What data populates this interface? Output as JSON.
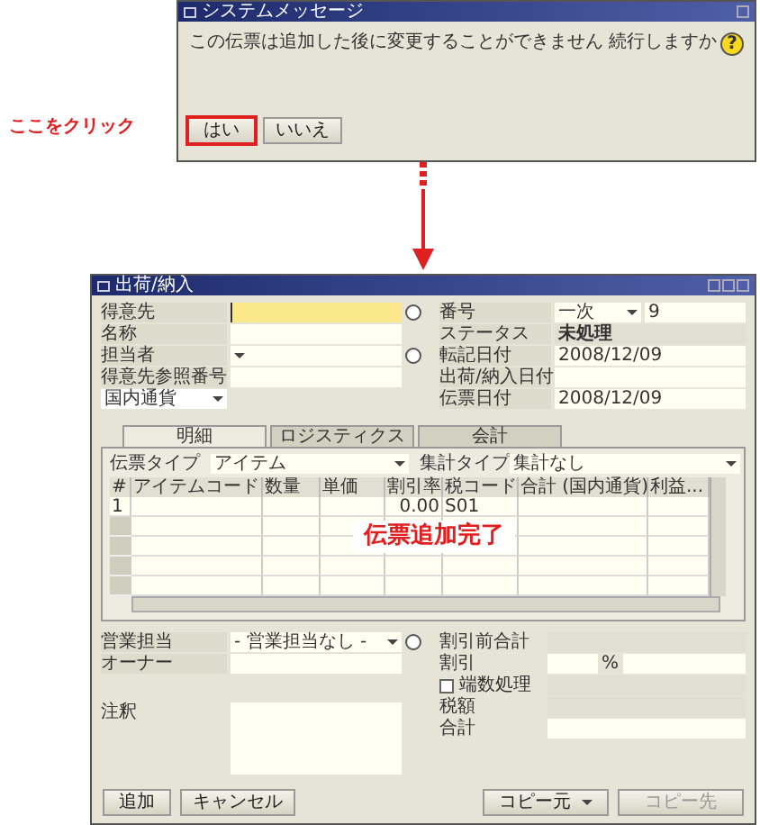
{
  "dialog": {
    "title": "システムメッセージ",
    "message": "この伝票は追加した後に変更することができません 続行しますか",
    "icon": "?",
    "buttons": [
      {
        "label": "はい",
        "highlighted": true
      },
      {
        "label": "いいえ",
        "highlighted": false
      }
    ]
  },
  "annotation": "ここをクリック",
  "window": {
    "title": "出荷/納入",
    "left_fields": [
      {
        "label": "得意先",
        "kind": "lookup",
        "focused": true
      },
      {
        "label": "名称",
        "kind": "text",
        "focused": false
      },
      {
        "label": "担当者",
        "kind": "dropdown",
        "focused": false
      },
      {
        "label": "得意先参照番号",
        "kind": "text",
        "focused": false
      }
    ],
    "currency": "国内通貨",
    "right_fields": [
      {
        "label": "番号",
        "kind": "series",
        "series": "一次",
        "value": "9"
      },
      {
        "label": "ステータス",
        "kind": "status",
        "value": "未処理"
      },
      {
        "label": "転記日付",
        "kind": "text",
        "value": "2008/12/09"
      },
      {
        "label": "出荷/納入日付",
        "kind": "text"
      },
      {
        "label": "伝票日付",
        "kind": "text",
        "value": "2008/12/09"
      }
    ],
    "tabs": [
      {
        "label": "明細",
        "selected": true
      },
      {
        "label": "ロジスティクス",
        "selected": false
      },
      {
        "label": "会計",
        "selected": false
      }
    ],
    "document_type": {
      "label": "伝票タイプ",
      "value": "アイテム"
    },
    "summary_type": {
      "label": "集計タイプ",
      "value": "集計なし"
    },
    "table": {
      "columns": [
        "#",
        "アイテムコード",
        "数量",
        "単価",
        "割引率",
        "税コード",
        "合計 (国内通貨)",
        "利益..."
      ],
      "rows": [
        [
          "1",
          "",
          "",
          "",
          "0.00",
          "S01",
          "",
          ""
        ],
        [
          "",
          "",
          "",
          "",
          "",
          "",
          "",
          ""
        ],
        [
          "",
          "",
          "",
          "",
          "",
          "",
          "",
          ""
        ],
        [
          "",
          "",
          "",
          "",
          "",
          "",
          "",
          ""
        ],
        [
          "",
          "",
          "",
          "",
          "",
          "",
          "",
          ""
        ]
      ]
    },
    "overlay": "伝票追加完了",
    "sales_employee": {
      "label": "営業担当",
      "value": "- 営業担当なし -"
    },
    "owner": {
      "label": "オーナー"
    },
    "remarks": {
      "label": "注釈"
    },
    "totals": [
      {
        "label": "割引前合計",
        "kind": "amount"
      },
      {
        "label": "割引",
        "kind": "percent",
        "unit": "%"
      },
      {
        "label": "端数処理",
        "kind": "checkbox",
        "checked": false
      },
      {
        "label": "税額",
        "kind": "amount"
      },
      {
        "label": "合計",
        "kind": "amount"
      }
    ],
    "buttons": [
      {
        "label": "追加",
        "kind": "button",
        "disabled": false
      },
      {
        "label": "キャンセル",
        "kind": "button",
        "disabled": false
      },
      {
        "label": "コピー元",
        "kind": "dropdown",
        "disabled": false
      },
      {
        "label": "コピー先",
        "kind": "button",
        "disabled": true
      }
    ]
  }
}
